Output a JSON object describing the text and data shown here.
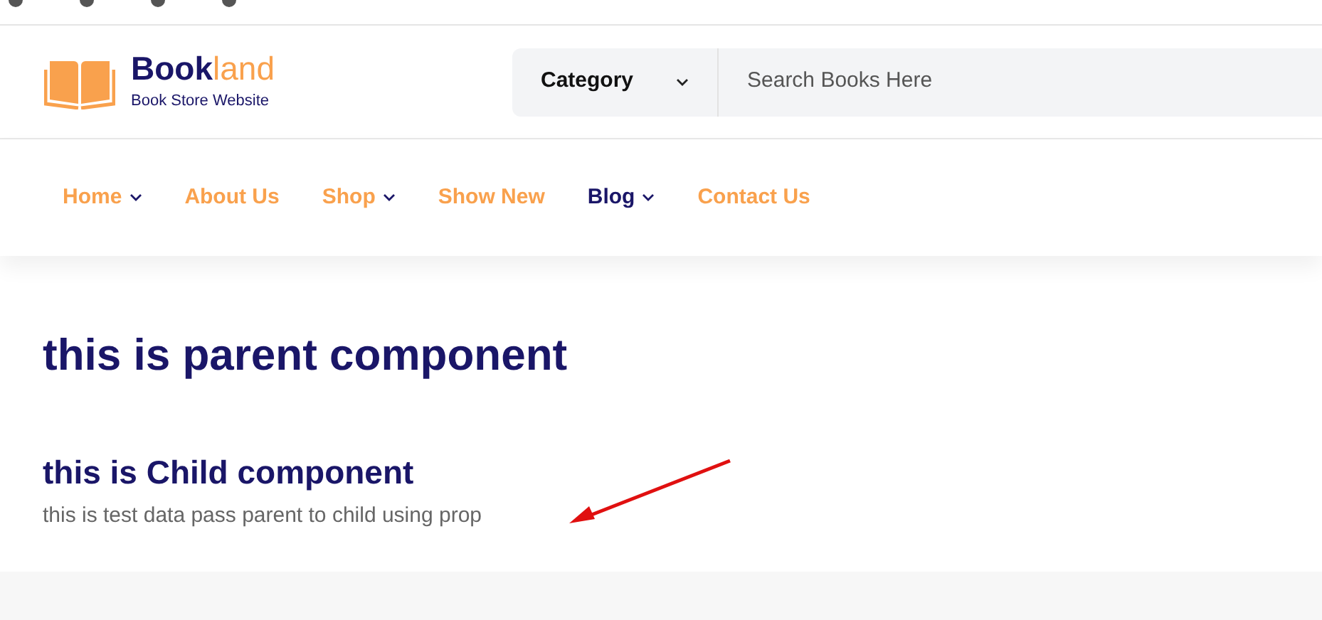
{
  "logo": {
    "brand_dark": "Book",
    "brand_light": "land",
    "tagline": "Book Store Website"
  },
  "search": {
    "category": "Category",
    "placeholder": "Search Books Here"
  },
  "nav": [
    {
      "label": "Home",
      "dropdown": true,
      "selected": false
    },
    {
      "label": "About Us",
      "dropdown": false,
      "selected": false
    },
    {
      "label": "Shop",
      "dropdown": true,
      "selected": false
    },
    {
      "label": "Show New",
      "dropdown": false,
      "selected": false
    },
    {
      "label": "Blog",
      "dropdown": true,
      "selected": true
    },
    {
      "label": "Contact Us",
      "dropdown": false,
      "selected": false
    }
  ],
  "content": {
    "parent_heading": "this is parent component",
    "child_heading": "this is Child component",
    "child_text": "this is test data pass parent to child using prop"
  }
}
